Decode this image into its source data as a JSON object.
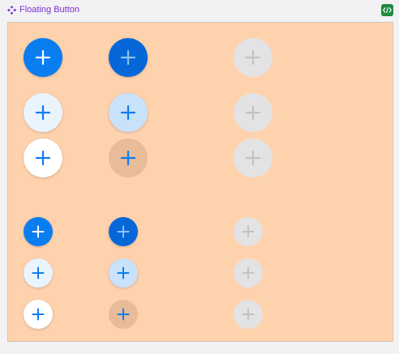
{
  "header": {
    "title": "Floating Button",
    "component_icon": "component-diamond-icon",
    "code_icon": "code-brackets-icon"
  },
  "colors": {
    "frame_bg": "#ffd2ae",
    "title": "#7b2fd0",
    "primary": "#0a7df0",
    "primary_pressed": "#0668d8",
    "blue_light_bg": "#c9e2fb",
    "white_hover_bg": "#eaf4fd",
    "peach_pressed_bg": "#e8bc98",
    "disabled_bg": "#e3e3e5",
    "disabled_icon": "#b9b9bc"
  },
  "buttons": {
    "icon": "plus-icon",
    "groups": [
      {
        "size": "large",
        "rows": [
          [
            "primary-default",
            "primary-pressed",
            "disabled"
          ],
          [
            "white-hover",
            "blue-light",
            "disabled"
          ],
          [
            "white-default",
            "peach-pressed",
            "disabled"
          ]
        ]
      },
      {
        "size": "small",
        "rows": [
          [
            "primary-default",
            "primary-pressed",
            "disabled"
          ],
          [
            "white-hover",
            "blue-light",
            "disabled"
          ],
          [
            "white-default",
            "peach-pressed",
            "disabled"
          ]
        ]
      }
    ]
  }
}
